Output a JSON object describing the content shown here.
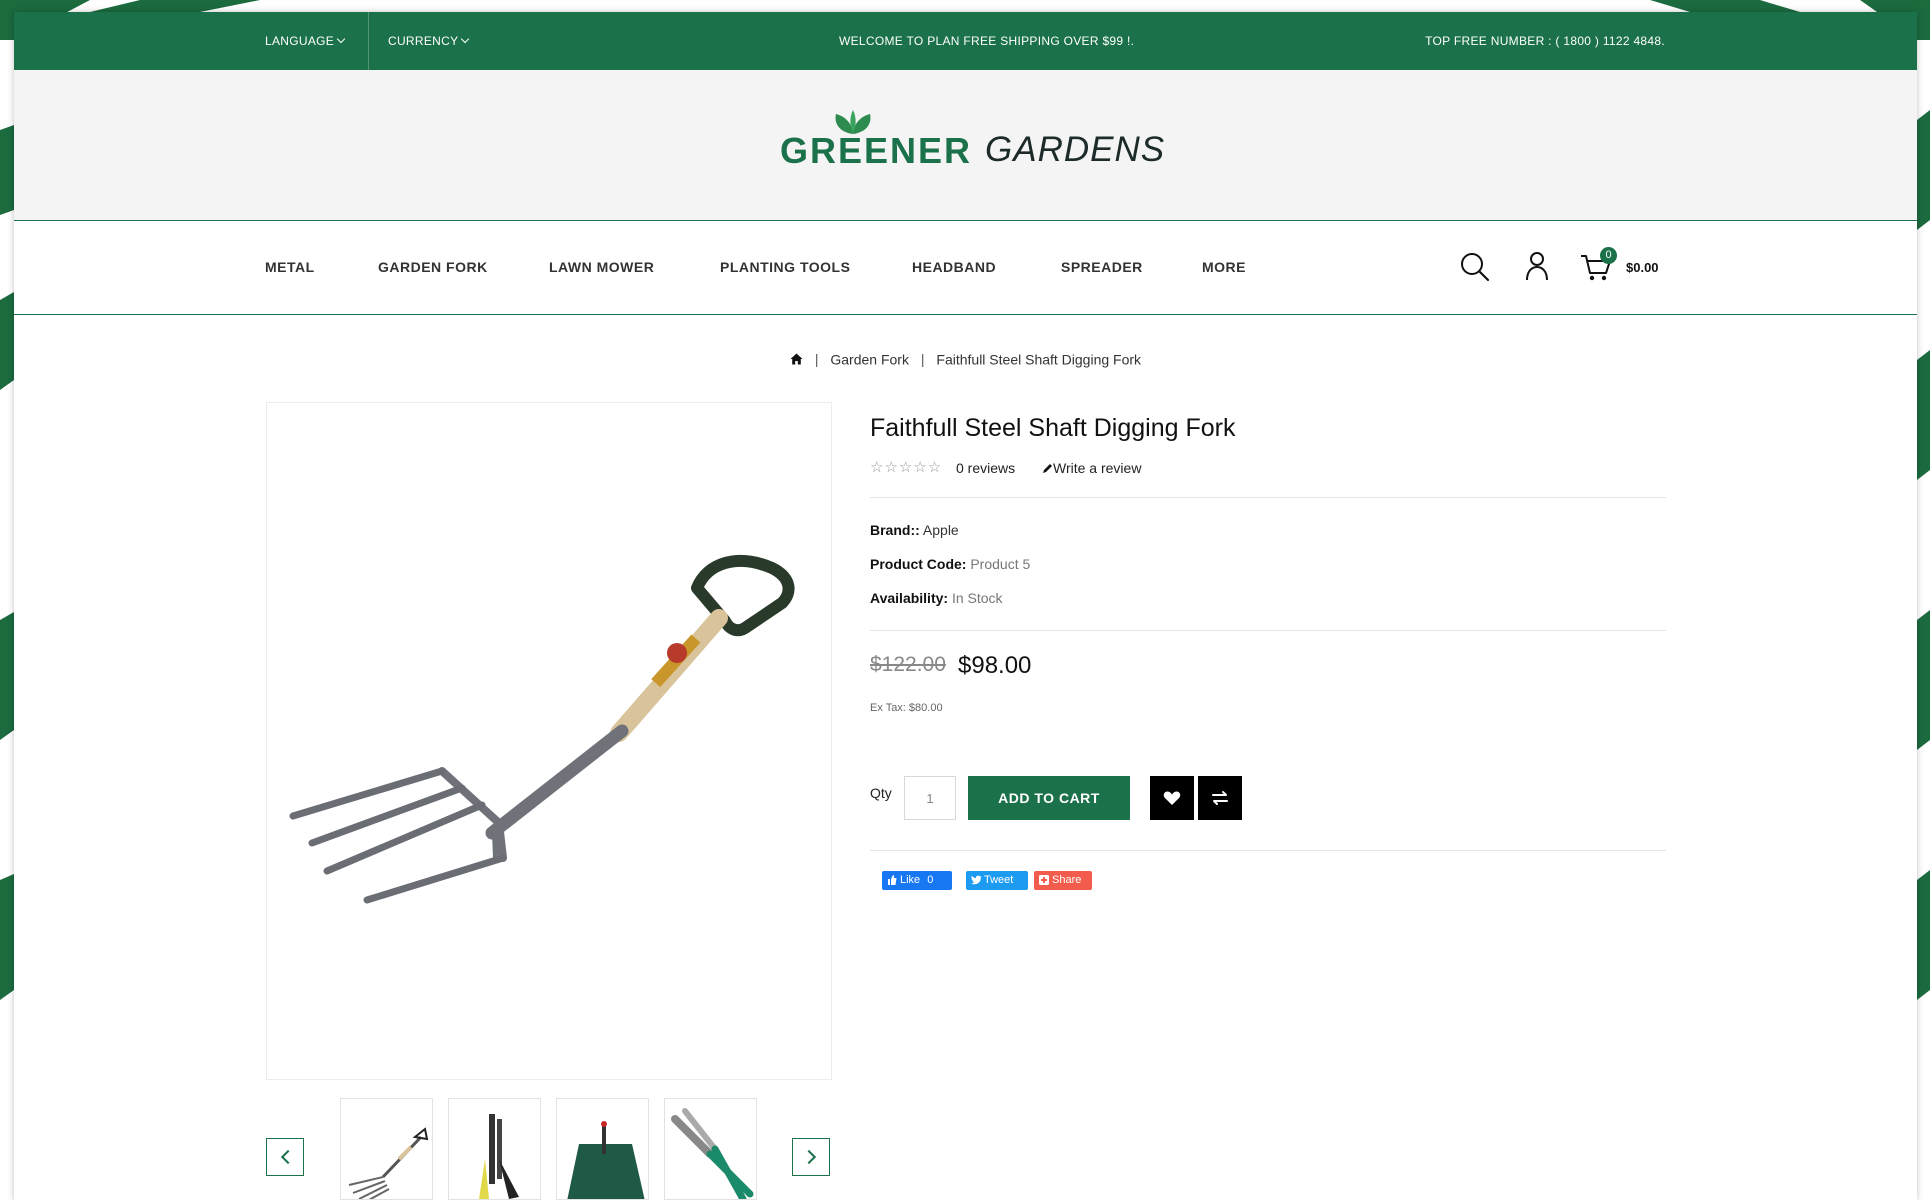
{
  "topbar": {
    "language_label": "LANGUAGE",
    "currency_label": "CURRENCY",
    "welcome_text": "WELCOME TO PLAN FREE SHIPPING OVER $99 !.",
    "phone_text": "TOP FREE NUMBER : ( 1800 ) 1122 4848."
  },
  "logo": {
    "part1": "GREENER",
    "part2": "GARDENS"
  },
  "nav": {
    "items": [
      {
        "label": "METAL"
      },
      {
        "label": "GARDEN FORK"
      },
      {
        "label": "LAWN MOWER"
      },
      {
        "label": "PLANTING TOOLS"
      },
      {
        "label": "HEADBAND"
      },
      {
        "label": "SPREADER"
      },
      {
        "label": "MORE"
      }
    ],
    "cart_count": "0",
    "cart_total": "$0.00",
    "icons": [
      "search-icon",
      "user-icon",
      "cart-icon"
    ]
  },
  "breadcrumb": {
    "home_icon": "home-icon",
    "items": [
      "Garden Fork",
      "Faithfull Steel Shaft Digging Fork"
    ]
  },
  "product": {
    "title": "Faithfull Steel Shaft Digging Fork",
    "rating": 0,
    "reviews_text": "0 reviews",
    "write_review": "Write a review",
    "brand_label": "Brand::",
    "brand_value": "Apple",
    "code_label": "Product Code:",
    "code_value": "Product 5",
    "availability_label": "Availability:",
    "availability_value": "In Stock",
    "old_price": "$122.00",
    "price": "$98.00",
    "ex_tax": "Ex Tax: $80.00",
    "qty_label": "Qty",
    "qty_value": "1",
    "add_to_cart": "ADD TO CART",
    "wishlist_icon": "heart-icon",
    "compare_icon": "compare-icon"
  },
  "social": {
    "like_label": "Like",
    "like_count": "0",
    "tweet_label": "Tweet",
    "share_label": "Share"
  },
  "colors": {
    "brand_green": "#1b7149",
    "dark": "#111111"
  }
}
